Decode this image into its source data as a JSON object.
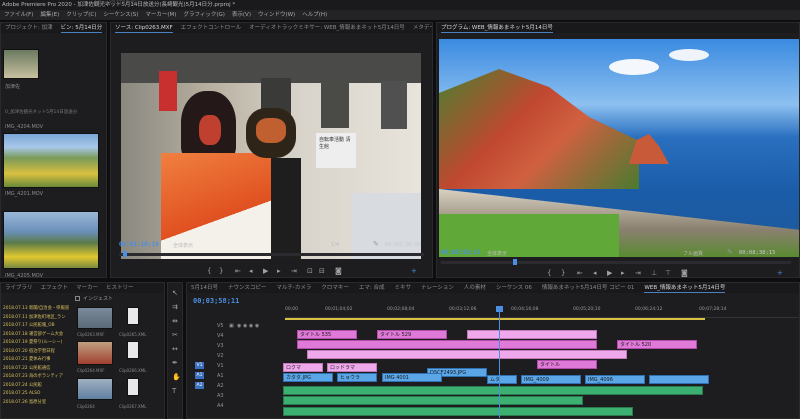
{
  "app": {
    "title": "Adobe Premiere Pro 2020 - 加津佐観光ネット5月14日放送分(長崎観光)5月14日分.prproj *",
    "bezel_text": "Ultra XB2783HSU"
  },
  "menu": [
    "ファイル(F)",
    "編集(E)",
    "クリップ(C)",
    "シーケンス(S)",
    "マーカー(M)",
    "グラフィック(G)",
    "表示(V)",
    "ウィンドウ(W)",
    "ヘルプ(H)"
  ],
  "left_panel": {
    "tabs": [
      "プロジェクト: 加津",
      "ビン: 5月14日分",
      "エフ"
    ],
    "path": "0_加津佐観光ネット5月14日放送分",
    "files": [
      "加津佐",
      "IMG_4201.MOV",
      "IMG_4205.MOV",
      "IMG_4204.MOV"
    ]
  },
  "source_monitor": {
    "tabs": [
      "ソース: Clip0263.MXF",
      "エフェクトコントロール",
      "オーディオトラックミキサー: WEB_情報あまネット5月14日号",
      "メタデータ"
    ],
    "timecode_current": "00;01;10;10",
    "fit": "全体表示",
    "scale": "1/4",
    "timecode_end": "00;00;20;00",
    "sign_text": "自転車活動 清生館"
  },
  "program_monitor": {
    "title": "プログラム: WEB_情報あまネット5月14日号",
    "timecode_current": "00;03;58;11",
    "fit": "全体表示",
    "quality": "フル画質",
    "timecode_end": "00;08;38;15"
  },
  "bottom_left": {
    "tabs": [
      "ライブラリ",
      "エフェクト",
      "マーカー",
      "ヒストリー"
    ],
    "search_label": "インジェスト",
    "bins": [
      "2018.07.13 新聞/自治会・県報道",
      "2018.07.11 加津佐町地区_ラン",
      "2018.07.17 公民館報_OB",
      "2018.07.18 運営部ゲーム大会",
      "2018.07.19 夏祭り(ルーシー)",
      "2018.07.20 宿泊学習日程",
      "2018.07.21 夏休み行事",
      "2018.07.22 公民館通信",
      "2018.07.23 海のボランティア",
      "2018.07.24 公民館",
      "2018.07.25 ALSO",
      "2018.07.26 島原分室"
    ],
    "clip_files": [
      "Clip0263.MXF",
      "Clip0264.MXF",
      "Clip0265.XML",
      "Clip0266.XML",
      "Clip0264",
      "Clip0265.XML",
      "Clip0266.XML",
      "Clip0267.XML"
    ]
  },
  "timeline": {
    "tabs": [
      "5月14日号",
      "ナウンスコピー",
      "マルチ-カメラ",
      "クロマキー",
      "エマ: 合成",
      "ミキサ",
      "ナレーション",
      "人の素材",
      "シーケンス 06",
      "情報あまネット5月14日号 コピー 01",
      "WEB_情報あまネット5月14日号"
    ],
    "timecode": "00;03;58;11",
    "ruler": [
      "00;00",
      "00;01;04;02",
      "00;02;08;04",
      "00;03;12;06",
      "00;04;16;08",
      "00;05;20;10",
      "00;06;24;12",
      "00;07;28;14"
    ],
    "tracks": [
      "V5",
      "V4",
      "V3",
      "V2",
      "V1",
      "A1",
      "A2",
      "A3",
      "A4"
    ],
    "clip_labels": {
      "title1": "タイトル 535",
      "title2": "タイトル 529",
      "title3": "タイトル 520",
      "title4": "タイトル",
      "v1a": "カタタ.JPG",
      "v1b": "ヒョウラ",
      "v1c": "IMG 4001",
      "v1d": "ムタ",
      "v1e": "IMG_4009",
      "v1f": "IMG_4096",
      "v2a": "ロクマ",
      "v2b": "ロッドラマ",
      "v2c": "DSCF2493.JPG"
    }
  }
}
